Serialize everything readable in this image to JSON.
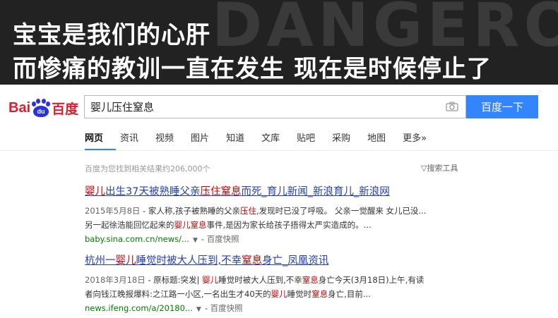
{
  "banner": {
    "line1": "宝宝是我们的心肝",
    "line2": "而惨痛的教训一直在发生 现在是时候停止了",
    "watermark": "DANGEROUS"
  },
  "logo": {
    "bai": "Bai",
    "du": "du",
    "cn": "百度"
  },
  "search": {
    "query": "婴儿压住窒息",
    "button_label": "百度一下"
  },
  "tabs": [
    "网页",
    "资讯",
    "视频",
    "图片",
    "知道",
    "文库",
    "贴吧",
    "采购",
    "地图",
    "更多»"
  ],
  "results_meta": {
    "count_text": "百度为您找到相关结果约206,000个",
    "tools_label": "▽搜索工具"
  },
  "results": [
    {
      "title_parts": [
        "婴儿",
        "出生37天被熟睡父亲",
        "压住",
        "窒息",
        "而死_育儿新闻_新浪育儿_新浪网"
      ],
      "date": "2015年5月8日",
      "abs1_parts": [
        " - 家人称,孩子被熟睡的父亲",
        "压住",
        ",发现时已没了呼吸。 父亲一觉醒来 女儿已没..."
      ],
      "abs2_parts": [
        "另一起徐浩能回忆起来的",
        "婴儿窒息",
        "事件,是因为家长给孩子捂得太严实造成的。..."
      ],
      "url": "baby.sina.com.cn/news/...",
      "cache_label": "百度快照"
    },
    {
      "title_parts": [
        "杭州一",
        "婴儿",
        "睡觉时被大人压到,不幸",
        "窒息",
        "身亡_凤凰资讯"
      ],
      "date": "2018年3月18日",
      "abs1_parts": [
        " - 原标题:突发| ",
        "婴儿",
        "睡觉时被大人压到,不幸",
        "窒息",
        "身亡今天(3月18日)上午,有读"
      ],
      "abs2_parts": [
        "者向钱江晚报爆料:之江路一小区,一名出生才40天的",
        "婴儿",
        "睡觉时",
        "窒息",
        "身亡,目前..."
      ],
      "url": "news.ifeng.com/a/20180...",
      "cache_label": "百度快照"
    }
  ],
  "colors": {
    "banner_bg": "#222222",
    "brand_red": "#de1e2e",
    "brand_blue": "#2932e1",
    "button_blue": "#3385ff",
    "link_blue": "#2440b3",
    "highlight_red": "#cc0000",
    "url_green": "#008000"
  }
}
